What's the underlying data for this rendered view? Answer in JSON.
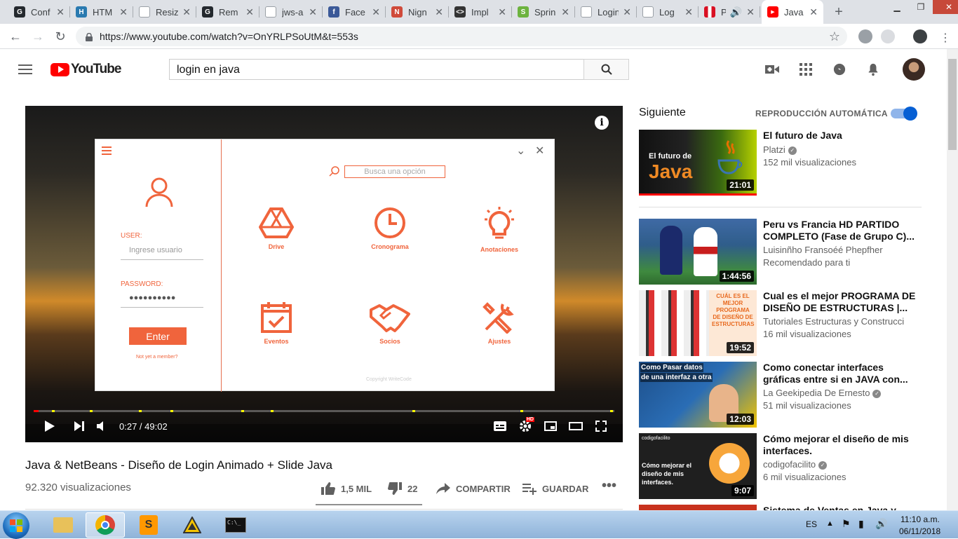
{
  "browser": {
    "tabs": [
      {
        "label": "Conf",
        "color": "#24292e",
        "glyph": "G"
      },
      {
        "label": "HTM",
        "color": "#2a7ab0",
        "glyph": "H"
      },
      {
        "label": "Resiz",
        "color": "#9aa0a6",
        "glyph": ""
      },
      {
        "label": "Rem",
        "color": "#24292e",
        "glyph": "G"
      },
      {
        "label": "jws-a",
        "color": "#9aa0a6",
        "glyph": ""
      },
      {
        "label": "Face",
        "color": "#3b5998",
        "glyph": "f"
      },
      {
        "label": "Nign",
        "color": "#d04a3a",
        "glyph": "N"
      },
      {
        "label": "Impl",
        "color": "#333333",
        "glyph": "<>"
      },
      {
        "label": "Sprin",
        "color": "#6db33f",
        "glyph": "S"
      },
      {
        "label": "Login",
        "color": "#9aa0a6",
        "glyph": ""
      },
      {
        "label": "Log",
        "color": "#9aa0a6",
        "glyph": ""
      },
      {
        "label": "P",
        "color": "#d91023",
        "glyph": ""
      },
      {
        "label": "Java",
        "color": "#ff0000",
        "glyph": "▶"
      }
    ],
    "url": "https://www.youtube.com/watch?v=OnYRLPSoUtM&t=553s"
  },
  "youtube": {
    "logo_text": "YouTube",
    "search_value": "login en java"
  },
  "player": {
    "time": "0:27 / 49:02",
    "progress_fraction": 0.009,
    "app": {
      "user_label": "USER:",
      "user_placeholder": "Ingrese usuario",
      "password_label": "PASSWORD:",
      "password_value": "●●●●●●●●●●",
      "enter_label": "Enter",
      "not_member": "Not yet a member?",
      "search_placeholder": "Busca una opción",
      "tiles": [
        "Drive",
        "Cronograma",
        "Anotaciones",
        "Eventos",
        "Socios",
        "Ajustes"
      ],
      "copyright": "Copyright WriteCode"
    }
  },
  "video": {
    "title": "Java & NetBeans - Diseño de Login Animado + Slide Java",
    "views": "92.320 visualizaciones",
    "likes": "1,5 MIL",
    "dislikes": "22",
    "share": "COMPARTIR",
    "save": "GUARDAR"
  },
  "sidebar": {
    "next_label": "Siguiente",
    "autoplay_label": "REPRODUCCIÓN AUTOMÁTICA",
    "items": [
      {
        "title": "El futuro de Java",
        "channel": "Platzi",
        "verified": true,
        "meta": "152 mil visualizaciones",
        "duration": "21:01"
      },
      {
        "title": "Peru vs Francia HD PARTIDO COMPLETO (Fase de Grupo C)...",
        "channel": "Luisinñho Fransoéé Phepfher",
        "verified": false,
        "meta": "Recomendado para ti",
        "duration": "1:44:56"
      },
      {
        "title": "Cual es el mejor PROGRAMA DE DISEÑO DE ESTRUCTURAS |...",
        "channel": "Tutoriales Estructuras y Construcci",
        "verified": false,
        "meta": "16 mil visualizaciones",
        "duration": "19:52"
      },
      {
        "title": "Como conectar interfaces gráficas entre si en JAVA con...",
        "channel": "La Geekipedia De Ernesto",
        "verified": true,
        "meta": "51 mil visualizaciones",
        "duration": "12:03"
      },
      {
        "title": "Cómo mejorar el diseño de mis interfaces.",
        "channel": "codigofacilito",
        "verified": true,
        "meta": "6 mil visualizaciones",
        "duration": "9:07"
      },
      {
        "title": "Sistema de Ventas en Java y",
        "channel": "",
        "verified": false,
        "meta": "",
        "duration": ""
      }
    ],
    "thumb_texts": [
      "El futuro de",
      "Java",
      "Como Pasar datos",
      "de una interfaz a otra",
      "Cómo mejorar el diseño de mis interfaces.",
      "codigofacilito"
    ]
  },
  "taskbar": {
    "lang": "ES",
    "time": "11:10 a.m.",
    "date": "06/11/2018"
  }
}
